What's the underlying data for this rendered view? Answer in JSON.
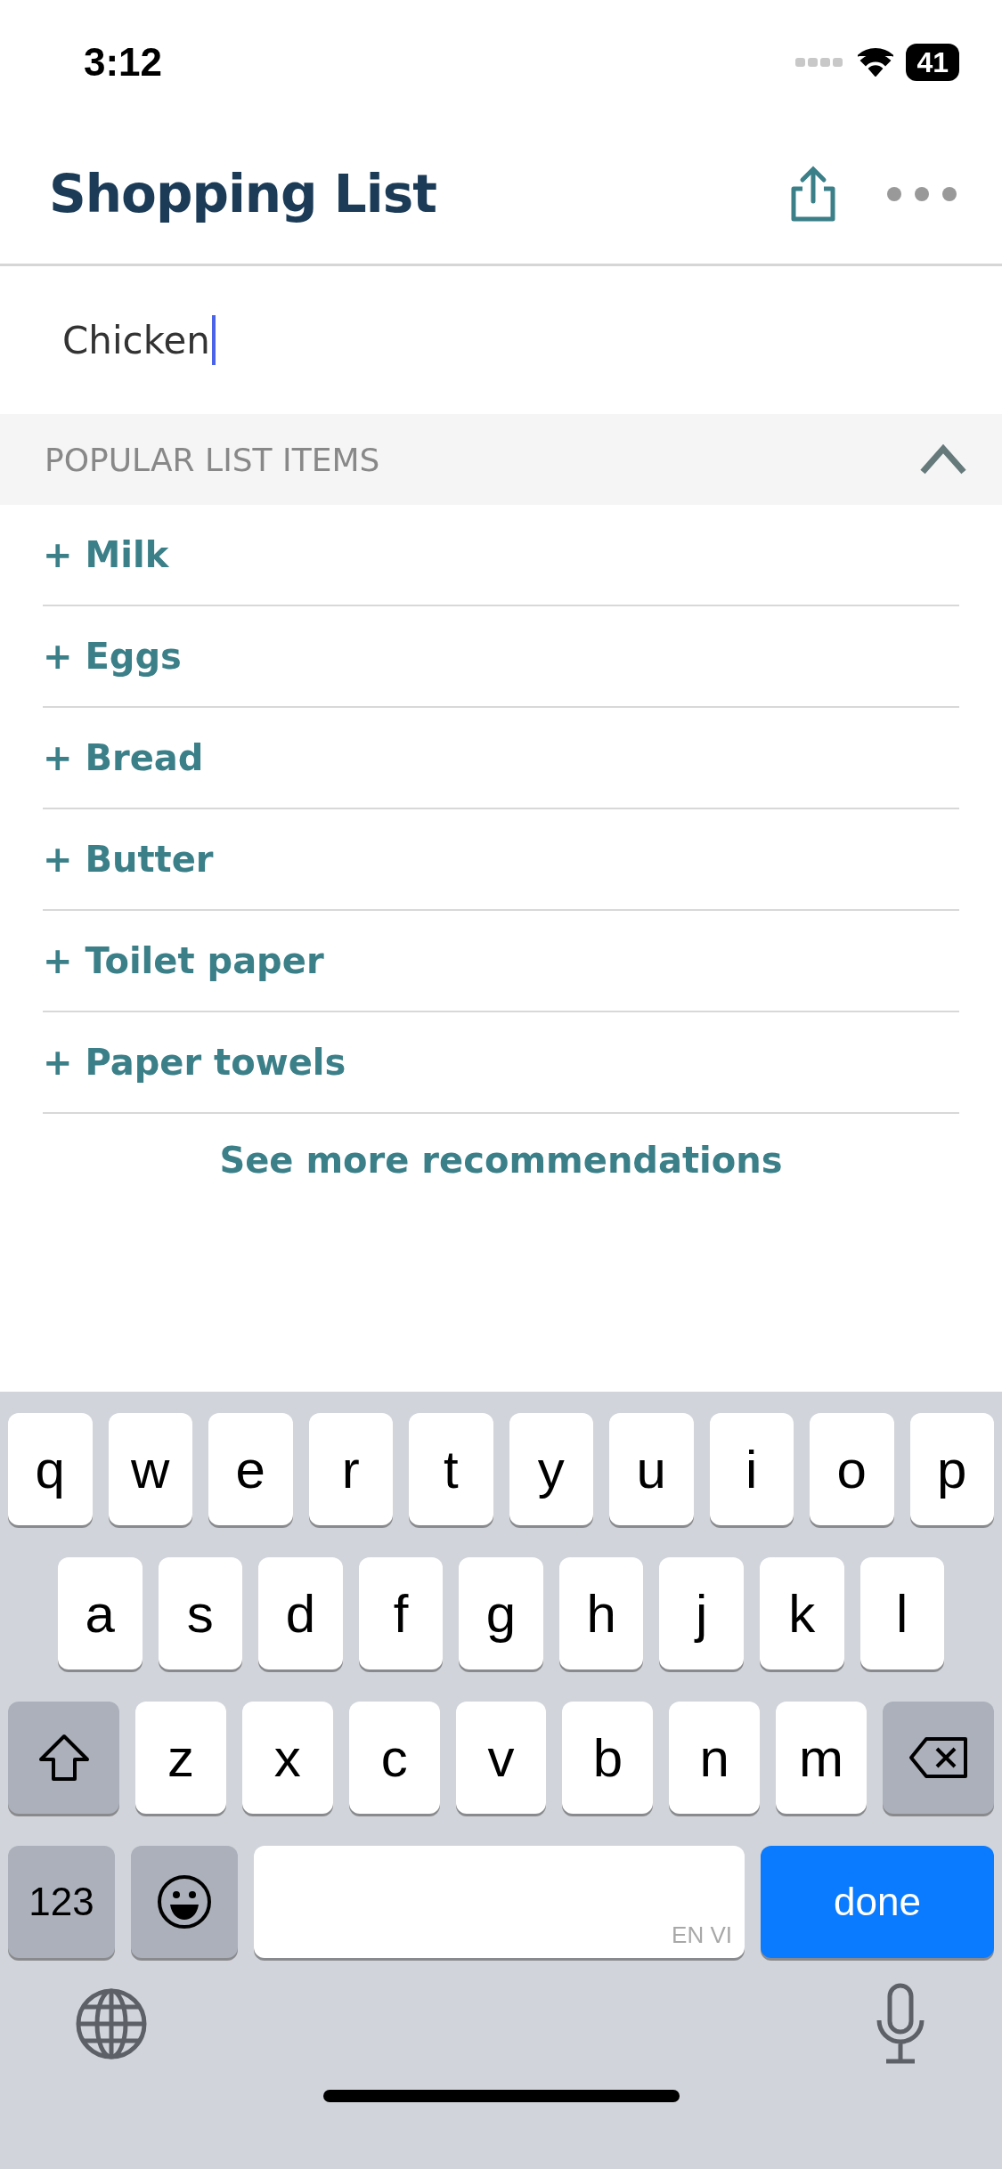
{
  "status_bar": {
    "time": "3:12",
    "battery": "41"
  },
  "header": {
    "title": "Shopping List"
  },
  "entry": {
    "value": "Chicken"
  },
  "section": {
    "title": "POPULAR LIST ITEMS",
    "expanded": true
  },
  "items": [
    {
      "label": "+ Milk"
    },
    {
      "label": "+ Eggs"
    },
    {
      "label": "+ Bread"
    },
    {
      "label": "+ Butter"
    },
    {
      "label": "+ Toilet paper"
    },
    {
      "label": "+ Paper towels"
    }
  ],
  "see_more": "See more recommendations",
  "keyboard": {
    "letter_rows": [
      [
        {
          "kind": "letter",
          "label": "q"
        },
        {
          "kind": "letter",
          "label": "w"
        },
        {
          "kind": "letter",
          "label": "e"
        },
        {
          "kind": "letter",
          "label": "r"
        },
        {
          "kind": "letter",
          "label": "t"
        },
        {
          "kind": "letter",
          "label": "y"
        },
        {
          "kind": "letter",
          "label": "u"
        },
        {
          "kind": "letter",
          "label": "i"
        },
        {
          "kind": "letter",
          "label": "o"
        },
        {
          "kind": "letter",
          "label": "p"
        }
      ],
      [
        {
          "kind": "letter",
          "label": "a"
        },
        {
          "kind": "letter",
          "label": "s"
        },
        {
          "kind": "letter",
          "label": "d"
        },
        {
          "kind": "letter",
          "label": "f"
        },
        {
          "kind": "letter",
          "label": "g"
        },
        {
          "kind": "letter",
          "label": "h"
        },
        {
          "kind": "letter",
          "label": "j"
        },
        {
          "kind": "letter",
          "label": "k"
        },
        {
          "kind": "letter",
          "label": "l"
        }
      ],
      [
        {
          "kind": "shift"
        },
        {
          "kind": "letter",
          "label": "z"
        },
        {
          "kind": "letter",
          "label": "x"
        },
        {
          "kind": "letter",
          "label": "c"
        },
        {
          "kind": "letter",
          "label": "v"
        },
        {
          "kind": "letter",
          "label": "b"
        },
        {
          "kind": "letter",
          "label": "n"
        },
        {
          "kind": "letter",
          "label": "m"
        },
        {
          "kind": "delete"
        }
      ]
    ],
    "bottom_row": {
      "numbers_key": "123",
      "space_hint": "EN VI",
      "done_key": "done"
    }
  }
}
